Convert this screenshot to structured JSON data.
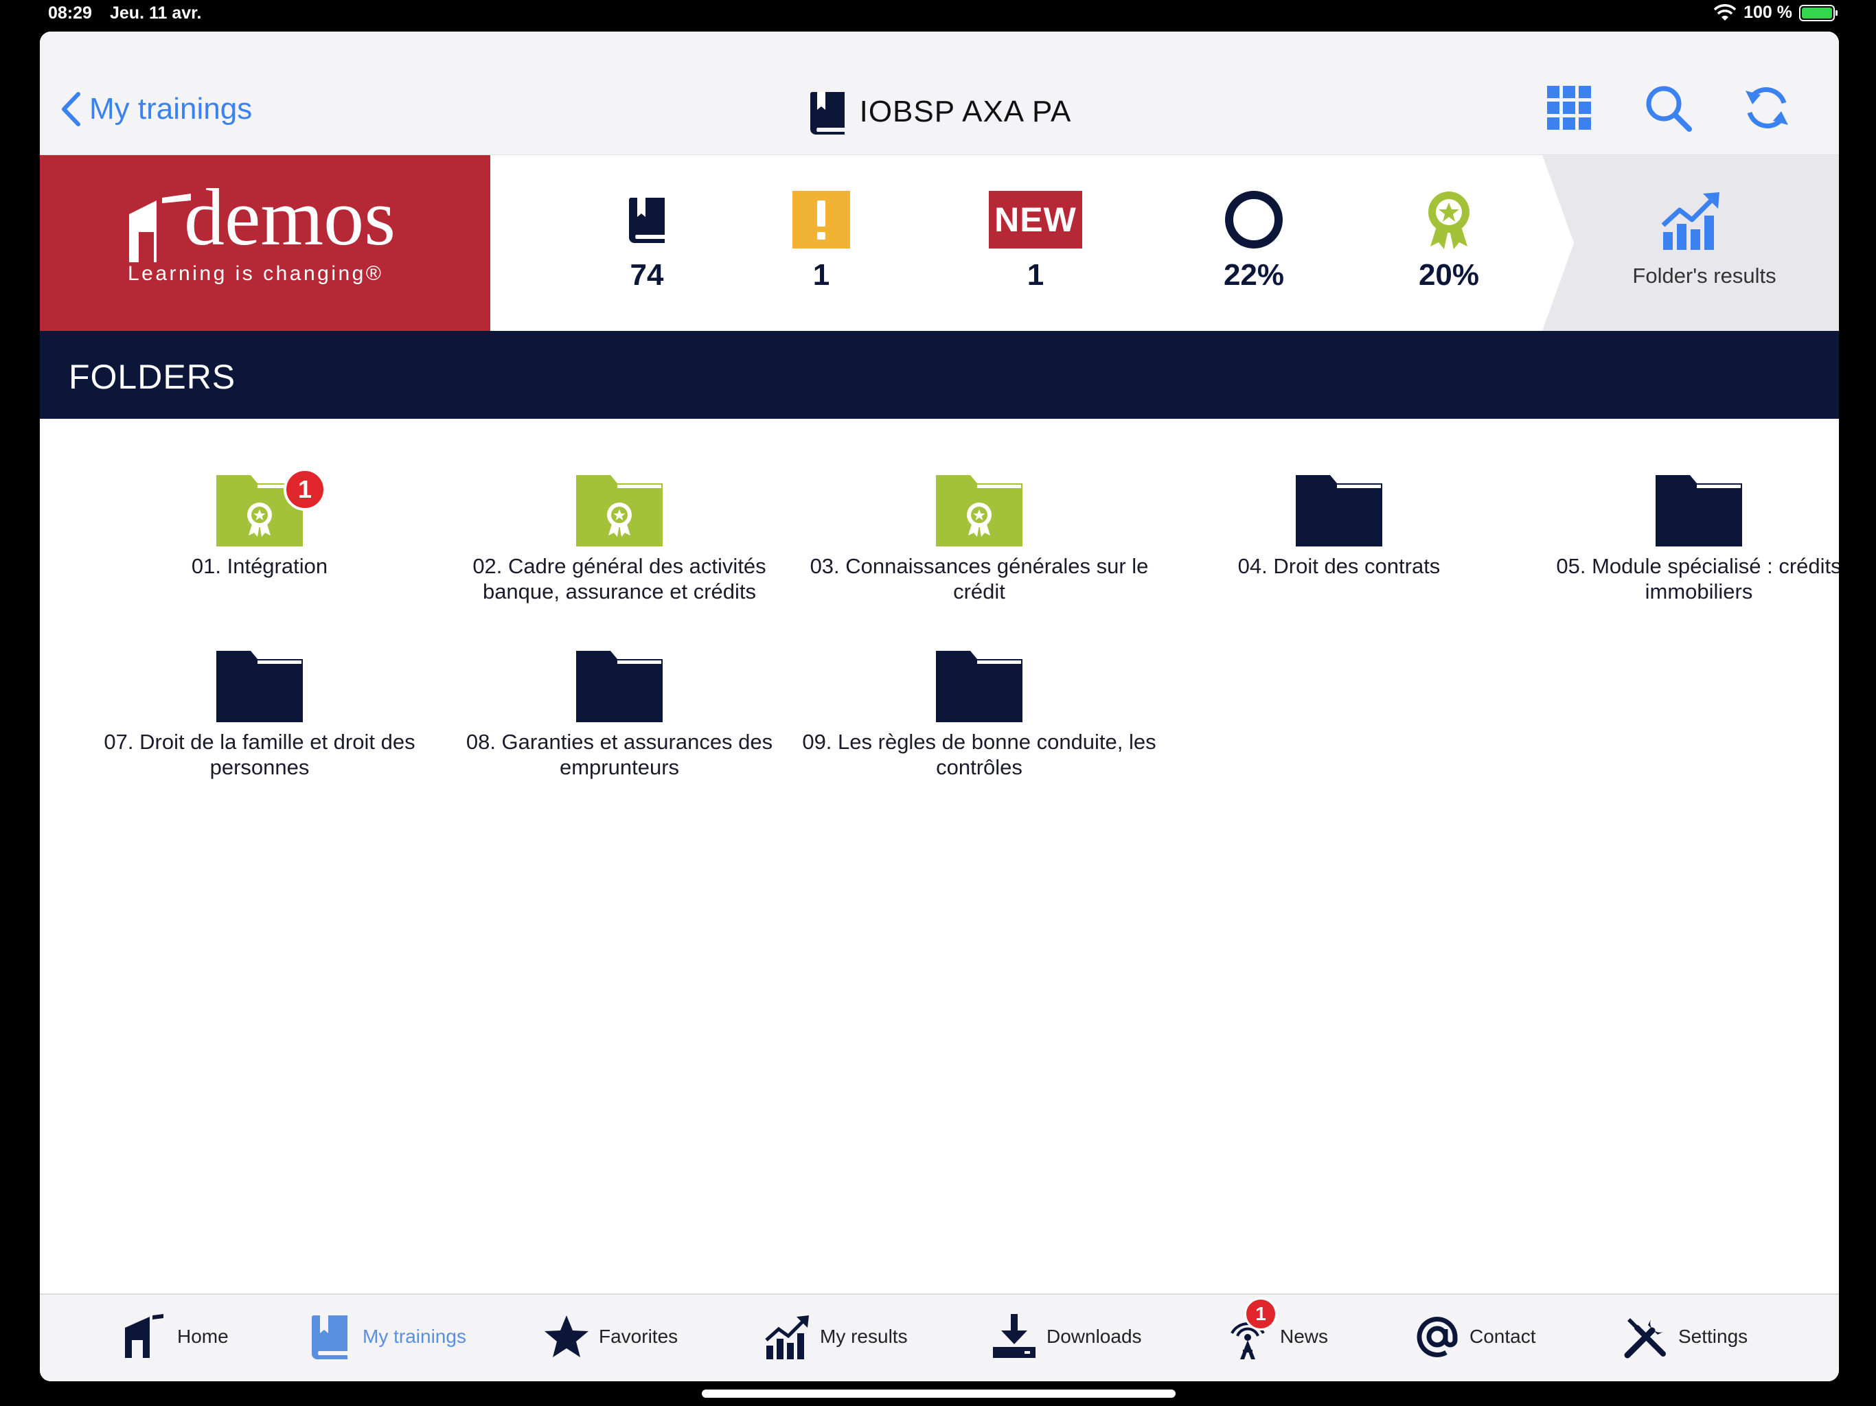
{
  "status_bar": {
    "time": "08:29",
    "date": "Jeu. 11 avr.",
    "battery": "100 %"
  },
  "nav": {
    "back_label": "My trainings",
    "title": "IOBSP AXA PA"
  },
  "logo": {
    "word": "demos",
    "tagline": "Learning is changing®"
  },
  "stats": {
    "items_count": "74",
    "alerts_count": "1",
    "new_badge": "NEW",
    "new_count": "1",
    "progress": "22%",
    "success": "20%"
  },
  "results_panel": {
    "label": "Folder's results"
  },
  "section": {
    "title": "FOLDERS"
  },
  "folders": [
    {
      "label": "01. Intégration",
      "badge": "1"
    },
    {
      "label": "02. Cadre général des activités banque, assurance et crédits"
    },
    {
      "label": "03. Connaissances générales sur le crédit"
    },
    {
      "label": "04. Droit des contrats"
    },
    {
      "label": "05. Module spécialisé : crédits immobiliers"
    },
    {
      "label": "07. Droit de la famille et droit des personnes"
    },
    {
      "label": "08. Garanties et assurances des emprunteurs"
    },
    {
      "label": "09. Les règles de bonne conduite, les contrôles"
    }
  ],
  "tabs": {
    "home": "Home",
    "trainings": "My trainings",
    "favorites": "Favorites",
    "results": "My results",
    "downloads": "Downloads",
    "news": "News",
    "news_badge": "1",
    "contact": "Contact",
    "settings": "Settings"
  },
  "colors": {
    "accent": "#3b82f0",
    "navy": "#0b1639",
    "brand_red": "#b62836",
    "green": "#a3c23a",
    "alert": "#f2b233",
    "badge_red": "#e0252b"
  }
}
